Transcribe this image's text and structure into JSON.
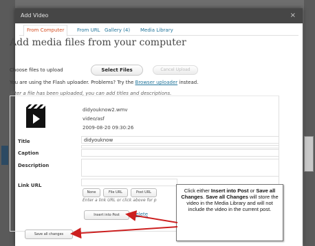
{
  "dialog": {
    "title": "Add Video",
    "close": "×"
  },
  "tabs": [
    "From Computer",
    "From URL",
    "Gallery (4)",
    "Media Library"
  ],
  "heading": "Add media files from your computer",
  "upload": {
    "choose_label": "Choose files to upload",
    "select_button": "Select Files",
    "cancel_button": "Cancel Upload",
    "flash_text_1": "You are using the Flash uploader. Problems? Try the",
    "browser_link": "Browser uploader",
    "flash_text_2": "instead.",
    "after_text": "After a file has been uploaded, you can add titles and descriptions."
  },
  "file": {
    "name": "didyouknow2.wmv",
    "type": "video/asf",
    "date": "2009-08-20 09:30:26",
    "title_label": "Title",
    "title_value": "didyouknow",
    "caption_label": "Caption",
    "description_label": "Description",
    "link_label": "Link URL",
    "link_buttons": [
      "None",
      "File URL",
      "Post URL"
    ],
    "link_hint": "Enter a link URL or click above for p",
    "insert_button": "Insert into Post",
    "delete_link": "Delete"
  },
  "save_all_button": "Save all changes",
  "callout": {
    "t1": "Click either ",
    "b1": "Insert into Post",
    "t2": " or ",
    "b2": "Save all Changes",
    "t3": ". ",
    "b3": "Save all Changes",
    "t4": " will store the video in the Media Library and will not include the video in the current post."
  },
  "colors": {
    "arrow": "#cc1f1f",
    "link": "#21759b",
    "active_tab": "#d54e21"
  }
}
